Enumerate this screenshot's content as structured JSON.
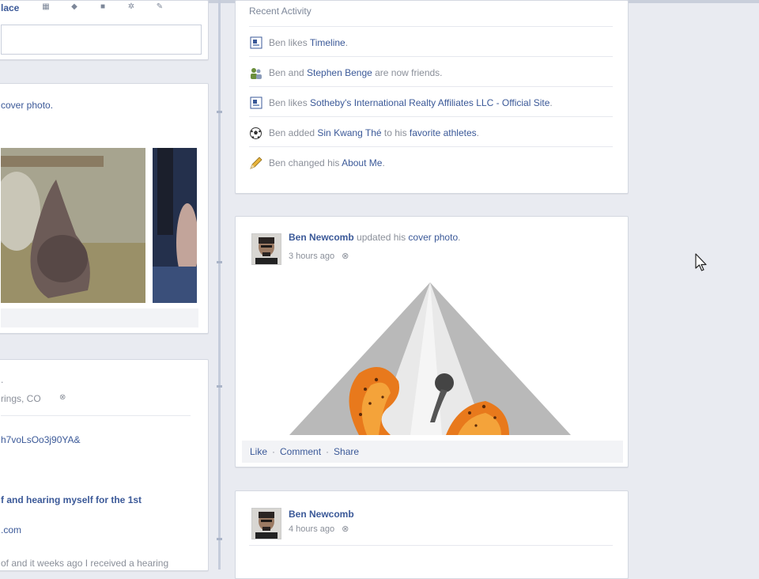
{
  "left": {
    "tab_label": "lace",
    "cover_text": "cover photo.",
    "location": "rings, CO",
    "short_link": "h7voLsOo3j90YA&",
    "headline": "f and hearing myself for the 1st",
    "domain": ".com",
    "body_text": "of and it weeks ago I received a hearing"
  },
  "activity": {
    "title": "Recent Activity",
    "items": [
      {
        "icon": "page-icon",
        "prefix": "Ben likes ",
        "link": "Timeline",
        "suffix": "."
      },
      {
        "icon": "friends-icon",
        "prefix": "Ben and ",
        "link": "Stephen Benge",
        "suffix": " are now friends."
      },
      {
        "icon": "page-icon",
        "prefix": "Ben likes ",
        "link": "Sotheby's International Realty Affiliates LLC - Official Site",
        "suffix": "."
      },
      {
        "icon": "soccer-ball-icon",
        "prefix": "Ben added ",
        "link": "Sin Kwang Thé",
        "mid": " to his ",
        "link2": "favorite athletes",
        "suffix": "."
      },
      {
        "icon": "pencil-icon",
        "prefix": "Ben changed his ",
        "link": "About Me",
        "suffix": "."
      }
    ]
  },
  "post1": {
    "author": "Ben Newcomb",
    "action": " updated his ",
    "action_link": "cover photo",
    "action_end": ".",
    "time": "3 hours ago",
    "actions": {
      "like": "Like",
      "comment": "Comment",
      "share": "Share",
      "sep": "·"
    }
  },
  "post2": {
    "author": "Ben Newcomb",
    "time": "4 hours ago"
  },
  "colors": {
    "link": "#3b5998",
    "muted": "#8a8f99",
    "background": "#e9ebf1"
  }
}
